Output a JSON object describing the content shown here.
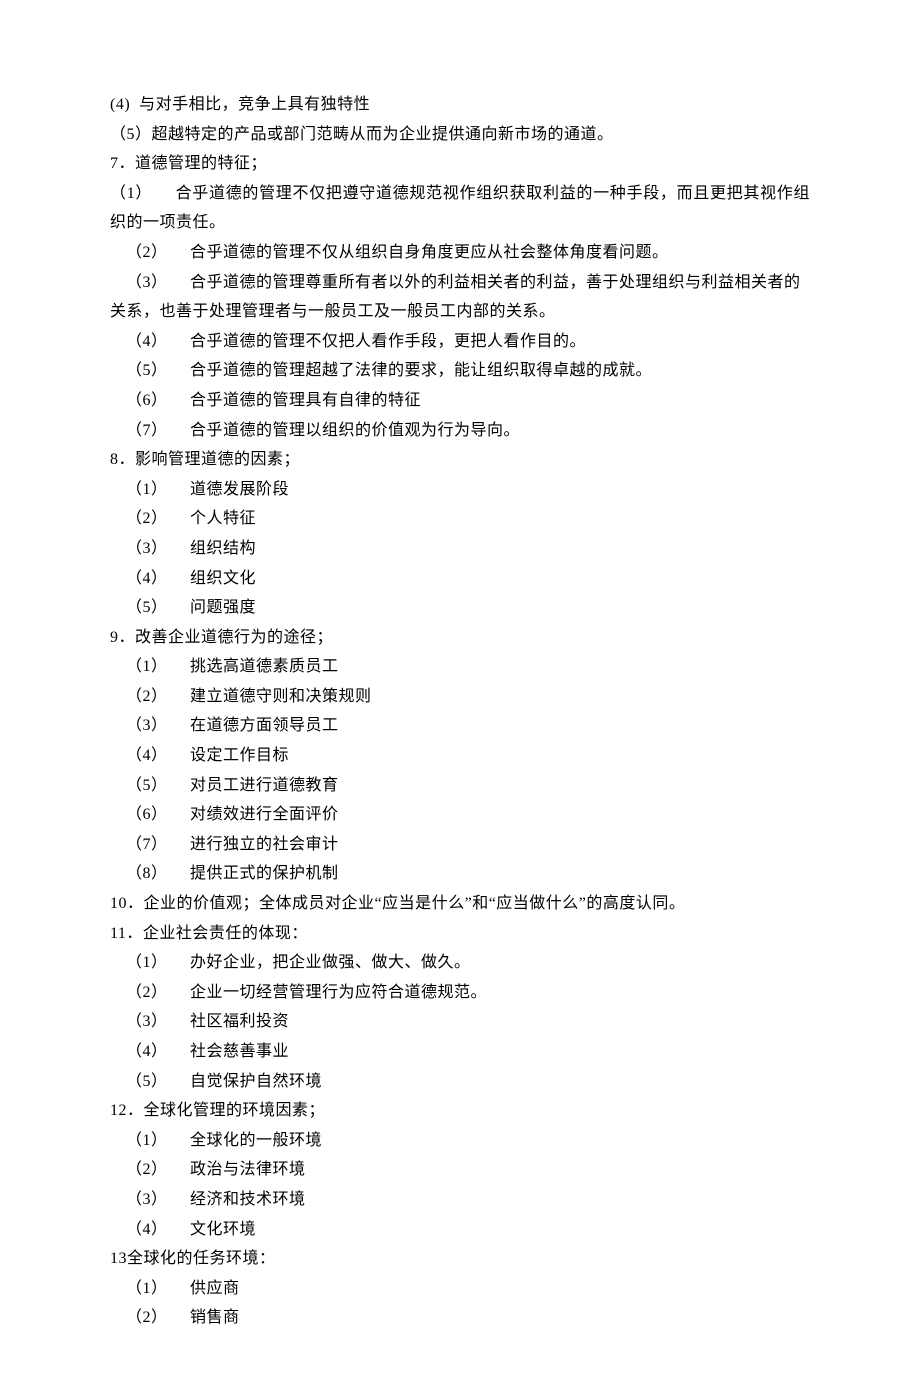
{
  "lines": [
    {
      "cls": "indent-0",
      "text": "(4)  与对手相比，竞争上具有独特性"
    },
    {
      "cls": "indent-0",
      "text": "（5）超越特定的产品或部门范畴从而为企业提供通向新市场的通道。"
    },
    {
      "cls": "indent-0",
      "text": "7．道德管理的特征；"
    },
    {
      "cls": "indent-0 justify",
      "text": "（1）     合乎道德的管理不仅把遵守道德规范视作组织获取利益的一种手段，而且更把其视作组织的一项责任。"
    },
    {
      "cls": "indent-1",
      "text": "（2）     合乎道德的管理不仅从组织自身角度更应从社会整体角度看问题。"
    },
    {
      "cls": "indent-1 justify",
      "text": "（3）     合乎道德的管理尊重所有者以外的利益相关者的利益，善于处理组织与利益相关者的"
    },
    {
      "cls": "indent-0",
      "text": "关系，也善于处理管理者与一般员工及一般员工内部的关系。"
    },
    {
      "cls": "indent-1",
      "text": "（4）     合乎道德的管理不仅把人看作手段，更把人看作目的。"
    },
    {
      "cls": "indent-1",
      "text": "（5）     合乎道德的管理超越了法律的要求，能让组织取得卓越的成就。"
    },
    {
      "cls": "indent-1",
      "text": "（6）     合乎道德的管理具有自律的特征"
    },
    {
      "cls": "indent-1",
      "text": "（7）     合乎道德的管理以组织的价值观为行为导向。"
    },
    {
      "cls": "indent-0",
      "text": "8．影响管理道德的因素；"
    },
    {
      "cls": "indent-1",
      "text": "（1）     道德发展阶段"
    },
    {
      "cls": "indent-1",
      "text": "（2）     个人特征"
    },
    {
      "cls": "indent-1",
      "text": "（3）     组织结构"
    },
    {
      "cls": "indent-1",
      "text": "（4）     组织文化"
    },
    {
      "cls": "indent-1",
      "text": "（5）     问题强度"
    },
    {
      "cls": "indent-0",
      "text": "9．改善企业道德行为的途径；"
    },
    {
      "cls": "indent-1",
      "text": "（1）     挑选高道德素质员工"
    },
    {
      "cls": "indent-1",
      "text": "（2）     建立道德守则和决策规则"
    },
    {
      "cls": "indent-1",
      "text": "（3）     在道德方面领导员工"
    },
    {
      "cls": "indent-1",
      "text": "（4）     设定工作目标"
    },
    {
      "cls": "indent-1",
      "text": "（5）     对员工进行道德教育"
    },
    {
      "cls": "indent-1",
      "text": "（6）     对绩效进行全面评价"
    },
    {
      "cls": "indent-1",
      "text": "（7）     进行独立的社会审计"
    },
    {
      "cls": "indent-1",
      "text": "（8）     提供正式的保护机制"
    },
    {
      "cls": "indent-0",
      "text": "10．企业的价值观；全体成员对企业“应当是什么”和“应当做什么”的高度认同。"
    },
    {
      "cls": "indent-0",
      "text": "11．企业社会责任的体现："
    },
    {
      "cls": "indent-1",
      "text": "（1）     办好企业，把企业做强、做大、做久。"
    },
    {
      "cls": "indent-1",
      "text": "（2）     企业一切经营管理行为应符合道德规范。"
    },
    {
      "cls": "indent-1",
      "text": "（3）     社区福利投资"
    },
    {
      "cls": "indent-1",
      "text": "（4）     社会慈善事业"
    },
    {
      "cls": "indent-1",
      "text": "（5）     自觉保护自然环境"
    },
    {
      "cls": "indent-0",
      "text": "12．全球化管理的环境因素；"
    },
    {
      "cls": "indent-1",
      "text": "（1）     全球化的一般环境"
    },
    {
      "cls": "indent-1",
      "text": "（2）     政治与法律环境"
    },
    {
      "cls": "indent-1",
      "text": "（3）     经济和技术环境"
    },
    {
      "cls": "indent-1",
      "text": "（4）     文化环境"
    },
    {
      "cls": "indent-0",
      "text": "13全球化的任务环境："
    },
    {
      "cls": "indent-1",
      "text": "（1）     供应商"
    },
    {
      "cls": "indent-1",
      "text": "（2）     销售商"
    }
  ]
}
